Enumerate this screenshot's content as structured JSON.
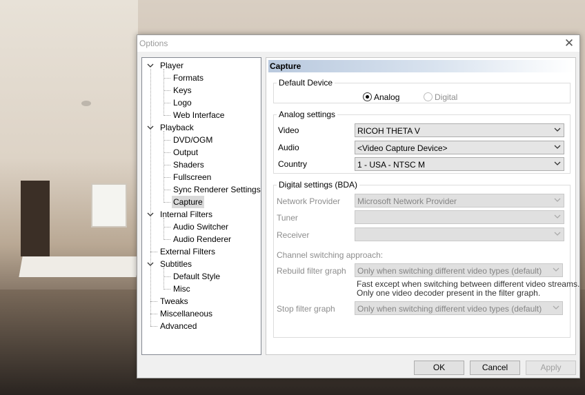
{
  "window": {
    "title": "Options"
  },
  "tree": [
    {
      "label": "Player",
      "level": 0,
      "expanded": true
    },
    {
      "label": "Formats",
      "level": 1
    },
    {
      "label": "Keys",
      "level": 1
    },
    {
      "label": "Logo",
      "level": 1
    },
    {
      "label": "Web Interface",
      "level": 1
    },
    {
      "label": "Playback",
      "level": 0,
      "expanded": true
    },
    {
      "label": "DVD/OGM",
      "level": 1
    },
    {
      "label": "Output",
      "level": 1
    },
    {
      "label": "Shaders",
      "level": 1
    },
    {
      "label": "Fullscreen",
      "level": 1
    },
    {
      "label": "Sync Renderer Settings",
      "level": 1
    },
    {
      "label": "Capture",
      "level": 1,
      "selected": true
    },
    {
      "label": "Internal Filters",
      "level": 0,
      "expanded": true
    },
    {
      "label": "Audio Switcher",
      "level": 1
    },
    {
      "label": "Audio Renderer",
      "level": 1
    },
    {
      "label": "External Filters",
      "level": 0
    },
    {
      "label": "Subtitles",
      "level": 0,
      "expanded": true
    },
    {
      "label": "Default Style",
      "level": 1
    },
    {
      "label": "Misc",
      "level": 1
    },
    {
      "label": "Tweaks",
      "level": 0
    },
    {
      "label": "Miscellaneous",
      "level": 0
    },
    {
      "label": "Advanced",
      "level": 0
    }
  ],
  "panel": {
    "header": "Capture",
    "default_device": {
      "label": "Default Device",
      "analog": "Analog",
      "digital": "Digital",
      "selected": "Analog"
    },
    "analog": {
      "label": "Analog settings",
      "video_label": "Video",
      "video_value": "RICOH THETA V",
      "audio_label": "Audio",
      "audio_value": "<Video Capture Device>",
      "country_label": "Country",
      "country_value": "1 - USA - NTSC M"
    },
    "digital": {
      "label": "Digital settings (BDA)",
      "network_label": "Network Provider",
      "network_value": "Microsoft Network Provider",
      "tuner_label": "Tuner",
      "receiver_label": "Receiver",
      "channel_label": "Channel switching approach:",
      "rebuild_label": "Rebuild filter graph",
      "rebuild_value": "Only when switching different video types (default)",
      "rebuild_hint_1": "Fast except when switching between different video streams.",
      "rebuild_hint_2": "Only one video decoder present in the filter graph.",
      "stop_label": "Stop filter graph",
      "stop_value": "Only when switching different video types (default)"
    }
  },
  "buttons": {
    "ok": "OK",
    "cancel": "Cancel",
    "apply": "Apply"
  }
}
